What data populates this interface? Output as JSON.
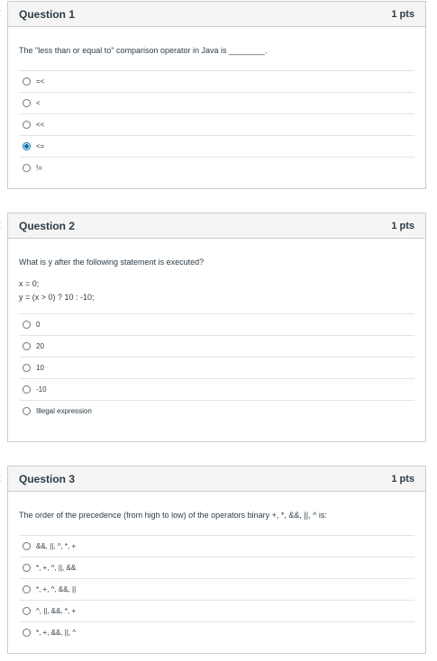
{
  "questions": [
    {
      "title": "Question 1",
      "points": "1 pts",
      "prompt": "The \"less than or equal to\" comparison operator in Java is ________.",
      "answers": [
        "=<",
        "<",
        "<<",
        "<=",
        "!="
      ],
      "selected_index": 3
    },
    {
      "title": "Question 2",
      "points": "1 pts",
      "prompt": "What is y after the following statement is executed?",
      "code_line_1": "x = 0;",
      "code_line_2": "y = (x > 0) ? 10 : -10;",
      "answers": [
        "0",
        "20",
        "10",
        "-10",
        "Illegal expression"
      ],
      "selected_index": null
    },
    {
      "title": "Question 3",
      "points": "1 pts",
      "prompt": "The order of the precedence (from high to low) of the operators binary +, *, &&, ||, ^ is:",
      "answers": [
        "&&, ||, ^, *, +",
        "*, +, ^, ||, &&",
        "*, +, ^, &&, ||",
        "^, ||, &&, *, +",
        "*, +, &&, ||, ^"
      ],
      "selected_index": null
    }
  ],
  "colors": {
    "accent": "#0770a3",
    "header_bg": "#f5f5f5",
    "border": "#c7cdd1",
    "text": "#2d3b45"
  }
}
